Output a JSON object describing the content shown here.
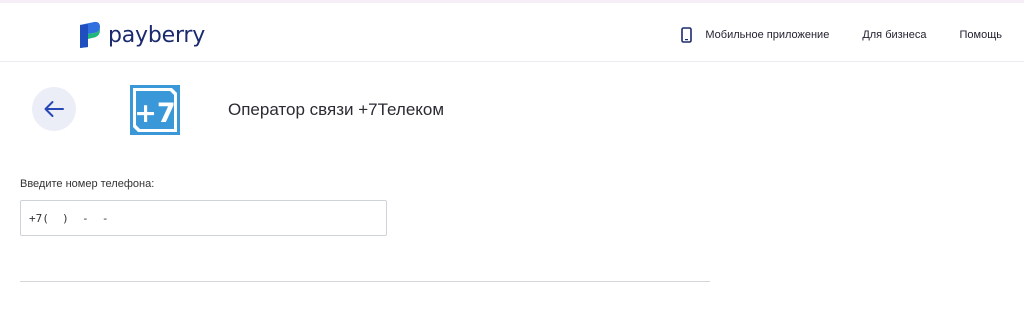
{
  "header": {
    "logo_text": "payberry",
    "nav": {
      "mobile_app": "Мобильное приложение",
      "business": "Для бизнеса",
      "help": "Помощь"
    }
  },
  "operator": {
    "logo_text": "+7",
    "title": "Оператор связи +7Телеком"
  },
  "form": {
    "phone_label": "Введите номер телефона:",
    "phone_value": "+7(  )  -  -"
  },
  "colors": {
    "brand_navy": "#1b2a6e",
    "brand_blue": "#2f6fe0",
    "brand_green": "#1fb87a",
    "operator_blue": "#3a97d8",
    "back_bg": "#eceef7"
  },
  "icons": {
    "back": "arrow-left-icon",
    "mobile_app": "smartphone-icon",
    "logo": "payberry-logo-mark"
  }
}
